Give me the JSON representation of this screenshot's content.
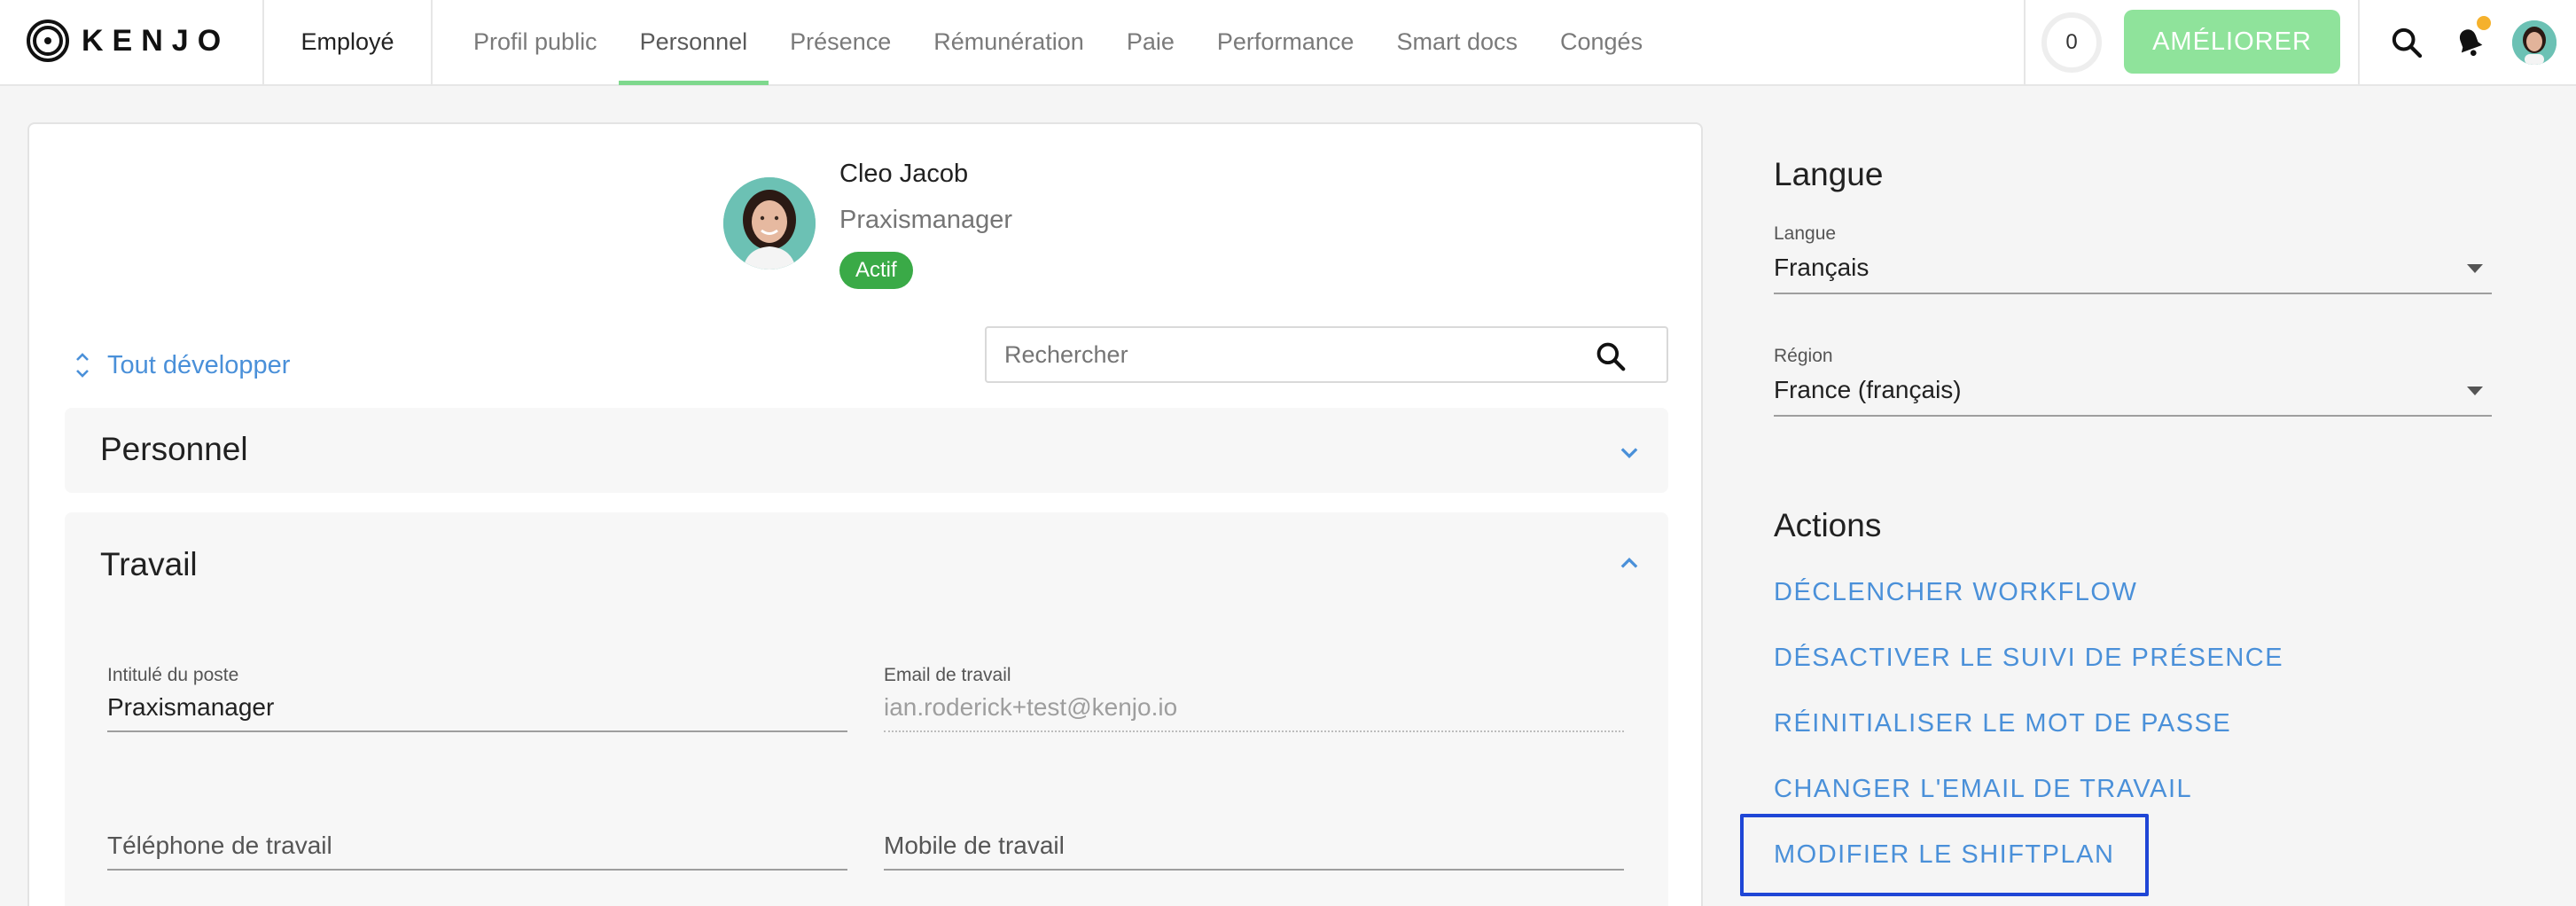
{
  "brand": {
    "name": "KENJO"
  },
  "header": {
    "employee_tab": "Employé",
    "tabs": [
      {
        "label": "Profil public"
      },
      {
        "label": "Personnel",
        "active": true
      },
      {
        "label": "Présence"
      },
      {
        "label": "Rémunération"
      },
      {
        "label": "Paie"
      },
      {
        "label": "Performance"
      },
      {
        "label": "Smart docs"
      },
      {
        "label": "Congés"
      }
    ],
    "counter": "0",
    "upgrade_label": "AMÉLIORER",
    "notification_dot_color": "#f5b12c"
  },
  "profile": {
    "name": "Cleo Jacob",
    "role": "Praxismanager",
    "status": "Actif",
    "status_color": "#3aaa47"
  },
  "toolbar": {
    "expand_all": "Tout développer",
    "search_placeholder": "Rechercher"
  },
  "sections": {
    "personal": {
      "title": "Personnel",
      "expanded": false
    },
    "work": {
      "title": "Travail",
      "expanded": true,
      "fields": {
        "job_title": {
          "label": "Intitulé du poste",
          "value": "Praxismanager"
        },
        "work_email": {
          "label": "Email de travail",
          "value": "ian.roderick+test@kenjo.io"
        },
        "work_phone": {
          "label": "Téléphone de travail"
        },
        "work_mobile": {
          "label": "Mobile de travail"
        }
      }
    }
  },
  "language_panel": {
    "title": "Langue",
    "language": {
      "label": "Langue",
      "value": "Français"
    },
    "region": {
      "label": "Région",
      "value": "France (français)"
    }
  },
  "actions_panel": {
    "title": "Actions",
    "items": [
      "DÉCLENCHER WORKFLOW",
      "DÉSACTIVER LE SUIVI DE PRÉSENCE",
      "RÉINITIALISER LE MOT DE PASSE",
      "CHANGER L'EMAIL DE TRAVAIL",
      "MODIFIER LE SHIFTPLAN"
    ]
  },
  "colors": {
    "accent_link": "#4a90d9",
    "upgrade_button": "#8fe39b",
    "active_tab_underline": "#7ed88d",
    "focus_outline": "#1f46d6"
  }
}
